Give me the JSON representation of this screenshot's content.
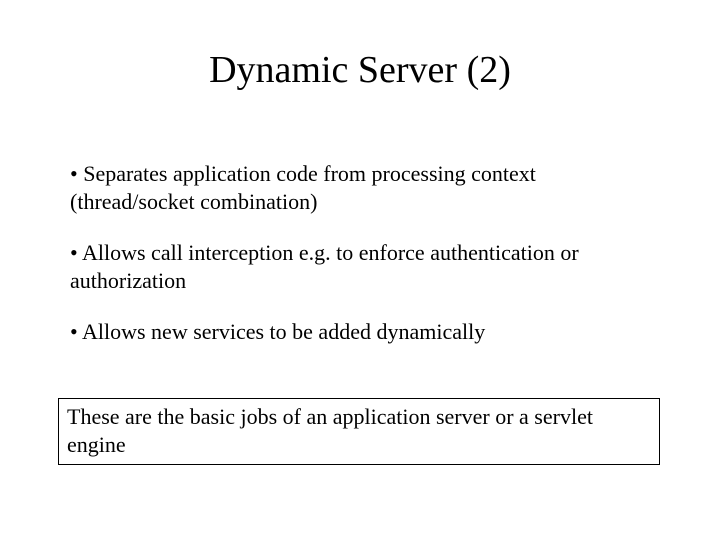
{
  "title": "Dynamic Server (2)",
  "bullets": [
    "• Separates application code from processing context (thread/socket combination)",
    "• Allows call interception e.g. to enforce authentication or authorization",
    "• Allows new services to be added dynamically"
  ],
  "note": "These are the basic jobs of an application server or a servlet engine"
}
